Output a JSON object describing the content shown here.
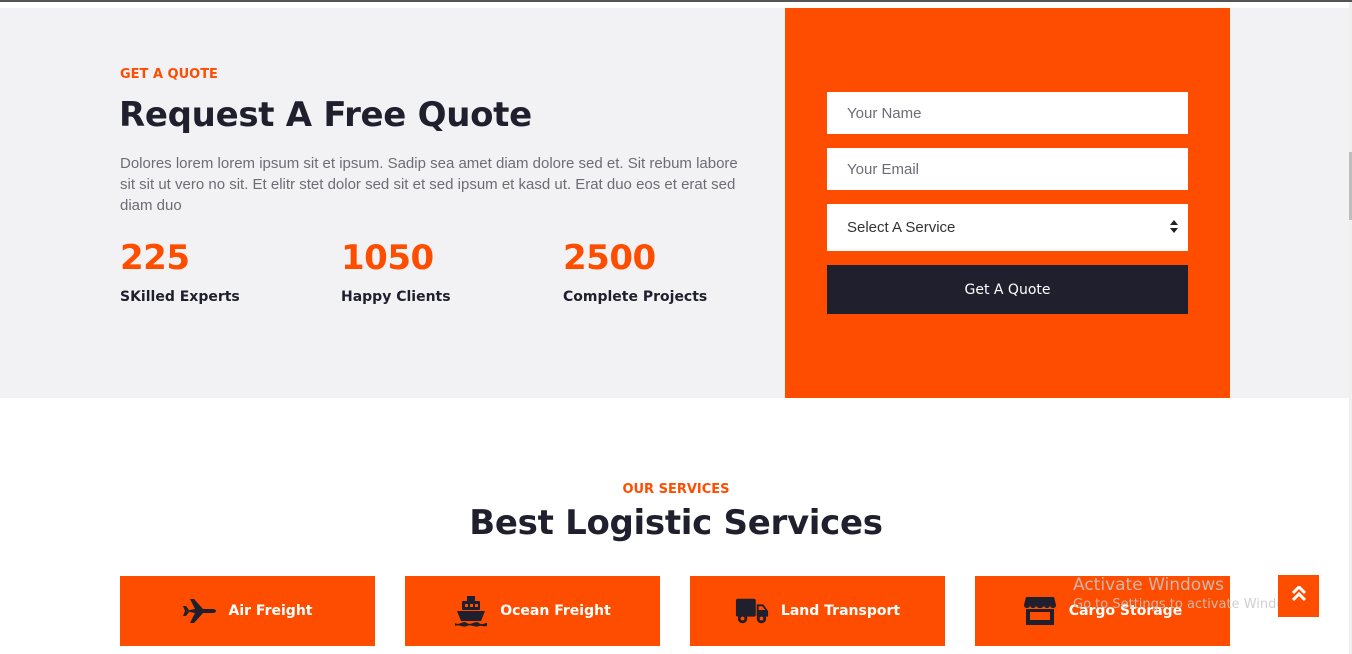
{
  "quote": {
    "eyebrow": "GET A QUOTE",
    "title": "Request A Free Quote",
    "description": "Dolores lorem lorem ipsum sit et ipsum. Sadip sea amet diam dolore sed et. Sit rebum labore sit sit ut vero no sit. Et elitr stet dolor sed sit et sed ipsum et kasd ut. Erat duo eos et erat sed diam duo",
    "stats": [
      {
        "number": "225",
        "label": "SKilled Experts"
      },
      {
        "number": "1050",
        "label": "Happy Clients"
      },
      {
        "number": "2500",
        "label": "Complete Projects"
      }
    ]
  },
  "form": {
    "name_placeholder": "Your Name",
    "email_placeholder": "Your Email",
    "service_selected": "Select A Service",
    "submit_label": "Get A Quote"
  },
  "services": {
    "eyebrow": "OUR SERVICES",
    "title": "Best Logistic Services",
    "items": [
      {
        "label": "Air Freight",
        "icon": "plane-icon"
      },
      {
        "label": "Ocean Freight",
        "icon": "ship-icon"
      },
      {
        "label": "Land Transport",
        "icon": "truck-icon"
      },
      {
        "label": "Cargo Storage",
        "icon": "warehouse-icon"
      }
    ]
  },
  "watermark": {
    "line1": "Activate Windows",
    "line2": "Go to Settings to activate Windows."
  },
  "colors": {
    "accent": "#ff4d00",
    "dark": "#1f1f2e",
    "section_bg": "#f2f2f4"
  }
}
